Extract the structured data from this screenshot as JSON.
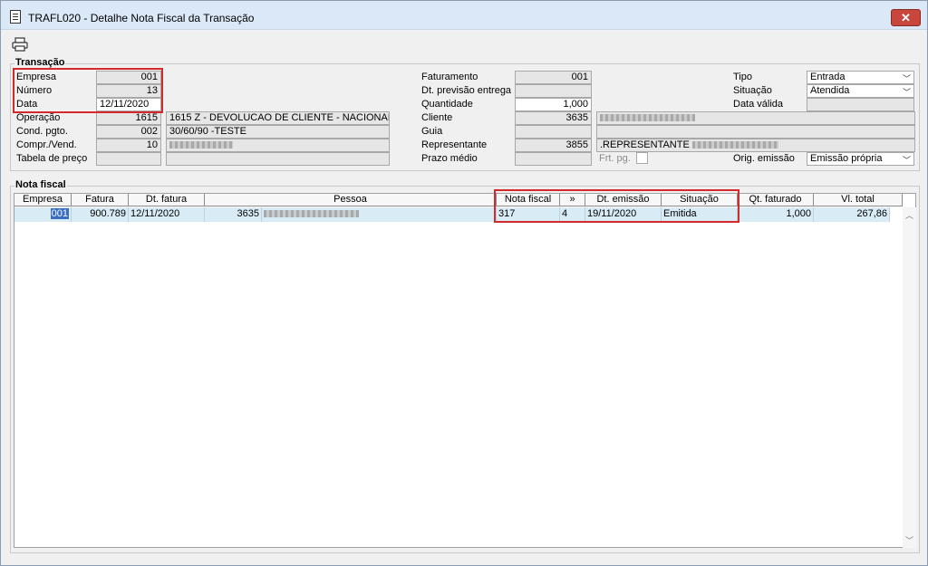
{
  "window": {
    "title": "TRAFL020 - Detalhe Nota Fiscal da Transação",
    "close_label": "✕"
  },
  "transacao": {
    "legend": "Transação",
    "empresa": {
      "label": "Empresa",
      "value": "001"
    },
    "numero": {
      "label": "Número",
      "value": "13"
    },
    "data": {
      "label": "Data",
      "value": "12/11/2020"
    },
    "operacao": {
      "label": "Operação",
      "code": "1615",
      "desc": "1615 Z - DEVOLUCAO DE CLIENTE - NACIONAL"
    },
    "cond_pgto": {
      "label": "Cond. pgto.",
      "code": "002",
      "desc": "30/60/90 -TESTE"
    },
    "compr_vend": {
      "label": "Compr./Vend.",
      "code": "10"
    },
    "tabela_preco": {
      "label": "Tabela de preço"
    },
    "faturamento": {
      "label": "Faturamento",
      "value": "001"
    },
    "dt_previsao": {
      "label": "Dt. previsão entrega",
      "value": ""
    },
    "quantidade": {
      "label": "Quantidade",
      "value": "1,000"
    },
    "cliente": {
      "label": "Cliente",
      "code": "3635"
    },
    "guia": {
      "label": "Guia"
    },
    "representante": {
      "label": "Representante",
      "code": "3855",
      "desc": ".REPRESENTANTE"
    },
    "prazo_medio": {
      "label": "Prazo médio"
    },
    "frt_pg": {
      "label": "Frt. pg."
    },
    "tipo": {
      "label": "Tipo",
      "value": "Entrada"
    },
    "situacao": {
      "label": "Situação",
      "value": "Atendida"
    },
    "data_valida": {
      "label": "Data válida"
    },
    "orig_emissao": {
      "label": "Orig. emissão",
      "value": "Emissão própria"
    }
  },
  "nota_fiscal": {
    "legend": "Nota fiscal",
    "columns": [
      "Empresa",
      "Fatura",
      "Dt. fatura",
      "Pessoa",
      "Nota fiscal",
      "»",
      "Dt. emissão",
      "Situação",
      "Qt. faturado",
      "Vl. total"
    ],
    "rows": [
      {
        "empresa": "001",
        "fatura": "900.789",
        "dt_fatura": "12/11/2020",
        "pessoa_code": "3635",
        "nota_fiscal": "317",
        "serie": "4",
        "dt_emissao": "19/11/2020",
        "situacao": "Emitida",
        "qt_faturado": "1,000",
        "vl_total": "267,86"
      }
    ]
  },
  "icons": {
    "print": "printer-icon",
    "close": "close-icon",
    "doc": "document-icon"
  },
  "colors": {
    "highlight": "#d42a2a",
    "titlebar": "#dae8f7",
    "row_bg": "#d9ecf5",
    "selection": "#3b6ec2"
  }
}
